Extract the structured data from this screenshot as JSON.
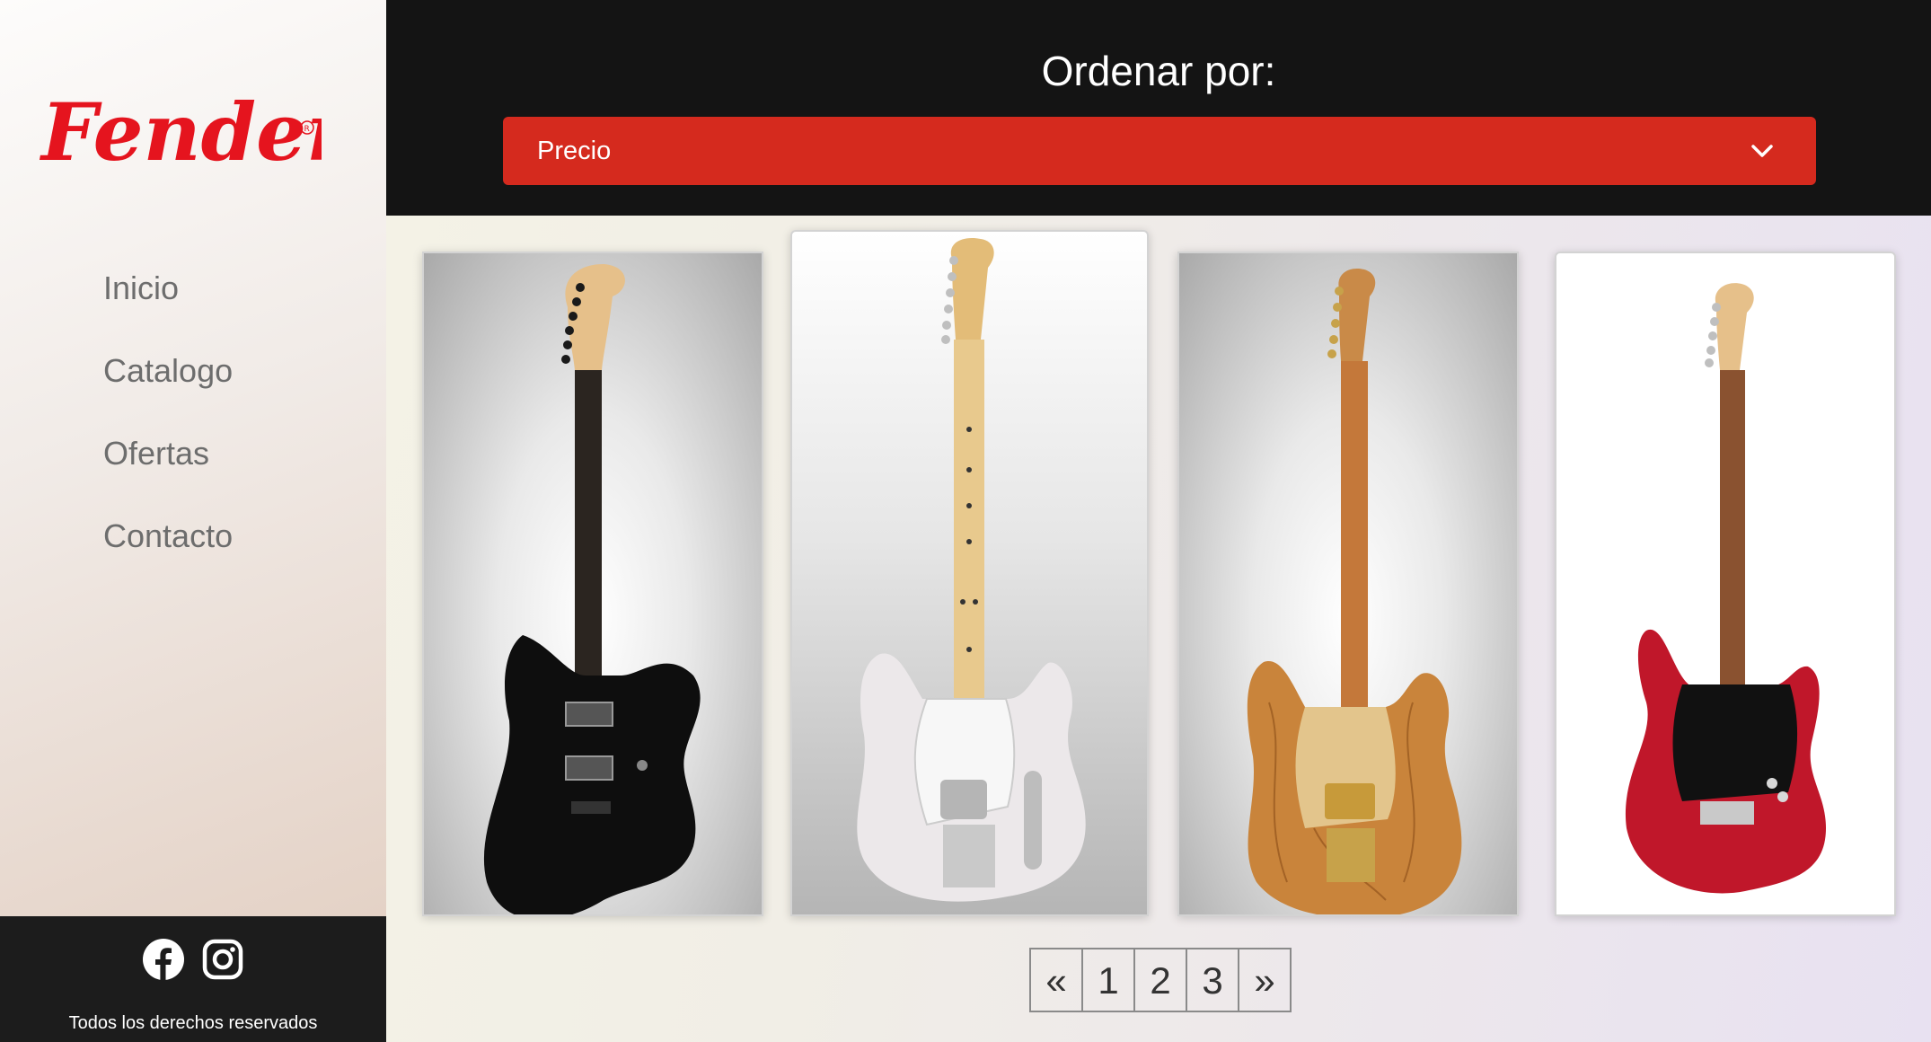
{
  "brand": {
    "logo_text": "Fender",
    "color": "#e5141e"
  },
  "nav": {
    "items": [
      {
        "label": "Inicio"
      },
      {
        "label": "Catalogo"
      },
      {
        "label": "Ofertas"
      },
      {
        "label": "Contacto"
      }
    ]
  },
  "footer": {
    "social": [
      "facebook-icon",
      "instagram-icon"
    ],
    "text": "Todos los derechos reservados"
  },
  "sort": {
    "title": "Ordenar por:",
    "selected": "Precio",
    "accent": "#d52a1e"
  },
  "products": [
    {
      "image": "black-jazzmaster-guitar",
      "body_color": "#111111"
    },
    {
      "image": "white-telecaster-guitar",
      "body_color": "#ebe7ea"
    },
    {
      "image": "spalted-maple-telecaster-guitar",
      "body_color": "#c9843b"
    },
    {
      "image": "red-lead-guitar",
      "body_color": "#c0172a"
    }
  ],
  "pagination": {
    "prev": "«",
    "pages": [
      "1",
      "2",
      "3"
    ],
    "next": "»"
  }
}
